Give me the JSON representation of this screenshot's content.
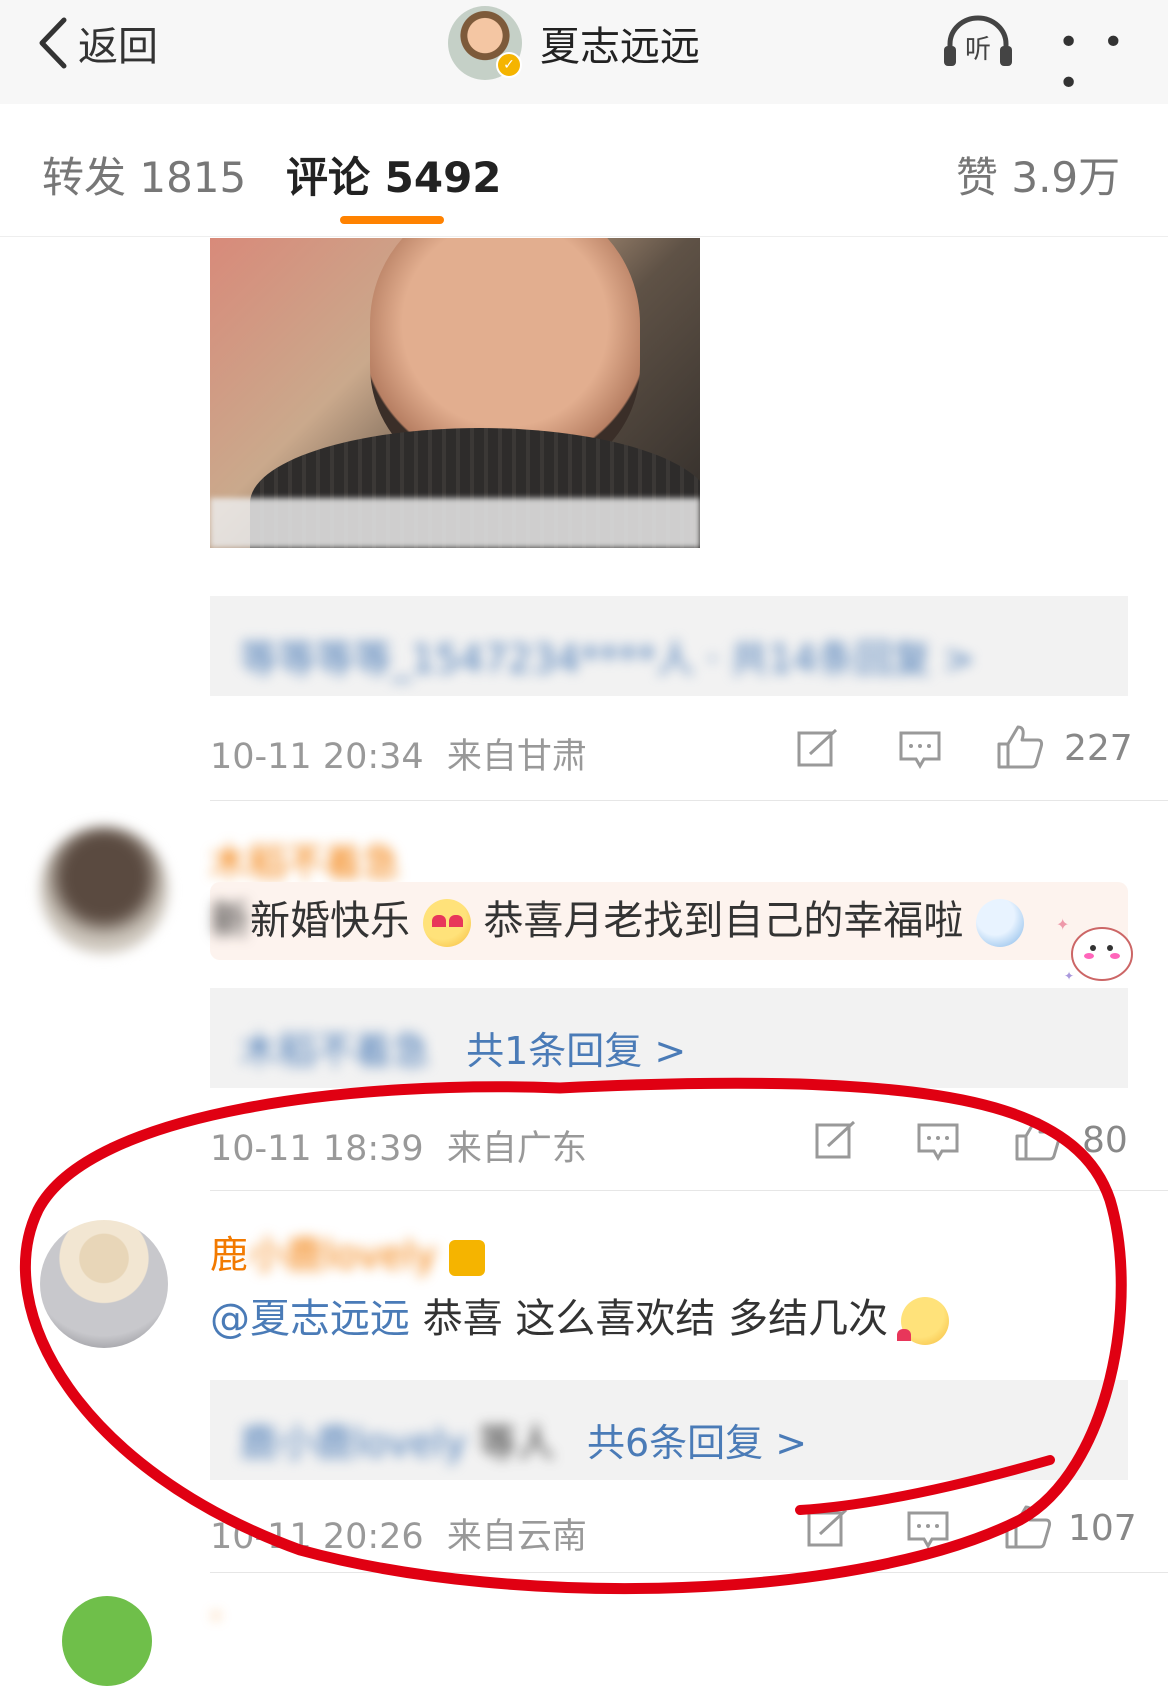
{
  "nav": {
    "back_label": "返回",
    "title": "夏志远远",
    "listen_label": "听",
    "more_label": "• • •"
  },
  "tabs": {
    "repost": "转发 1815",
    "comment": "评论 5492",
    "like": "赞 3.9万"
  },
  "comment1": {
    "reply_summary": "等等等等_1547234****人 · 共14条回复 >",
    "time": "10-11 20:34",
    "location": "来自甘肃",
    "likes": "227"
  },
  "comment2": {
    "name": "木稻不着急",
    "text_a": "新婚快乐",
    "text_b": "恭喜月老找到自己的幸福啦",
    "reply_prefix": "木稻不着急",
    "reply_summary": "共1条回复 >",
    "time": "10-11 18:39",
    "location": "来自广东",
    "likes": "80"
  },
  "comment3": {
    "name": "鹿",
    "name_rest": "小鹿lovely",
    "mention": "@夏志远远",
    "text": " 恭喜  这么喜欢结  多结几次",
    "reply_prefix": "鹿小鹿lovely",
    "reply_mid": "等人",
    "reply_summary": "共6条回复 >",
    "time": "10-11 20:26",
    "location": "来自云南",
    "likes": "107"
  },
  "colors": {
    "accent": "#ff8200",
    "link": "#4a7bb7",
    "name": "#f27a00",
    "annotation": "#e00012"
  }
}
